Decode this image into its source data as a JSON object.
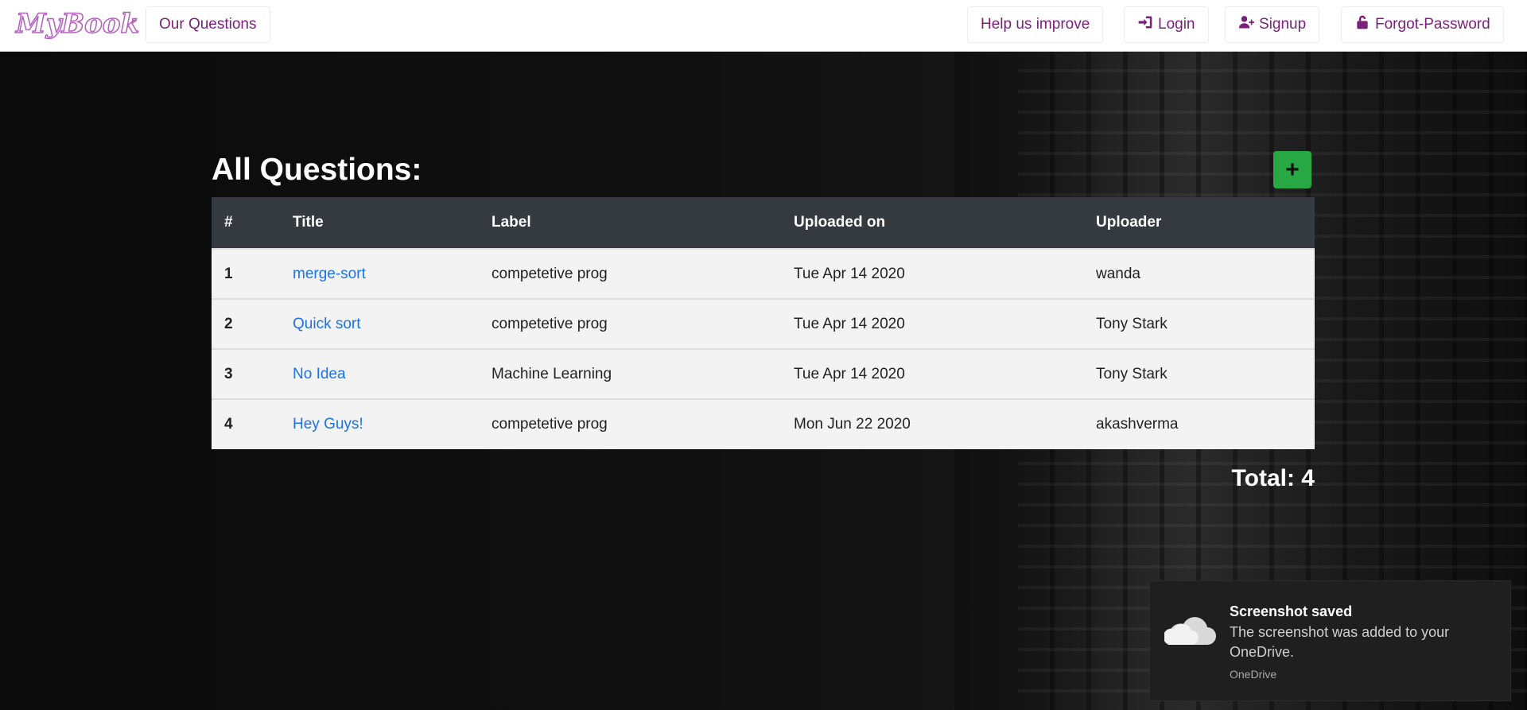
{
  "brand": "MyBook",
  "nav": {
    "questions": "Our Questions",
    "help": "Help us improve",
    "login": "Login",
    "signup": "Signup",
    "forgot": "Forgot-Password"
  },
  "page": {
    "heading": "All Questions:",
    "add_label": "+",
    "total": "Total: 4"
  },
  "table": {
    "headers": [
      "#",
      "Title",
      "Label",
      "Uploaded on",
      "Uploader"
    ],
    "rows": [
      {
        "num": "1",
        "title": "merge-sort",
        "label": "competetive prog",
        "date": "Tue Apr 14 2020",
        "uploader": "wanda"
      },
      {
        "num": "2",
        "title": "Quick sort",
        "label": "competetive prog",
        "date": "Tue Apr 14 2020",
        "uploader": "Tony Stark"
      },
      {
        "num": "3",
        "title": "No Idea",
        "label": "Machine Learning",
        "date": "Tue Apr 14 2020",
        "uploader": "Tony Stark"
      },
      {
        "num": "4",
        "title": "Hey Guys!",
        "label": "competetive prog",
        "date": "Mon Jun 22 2020",
        "uploader": "akashverma"
      }
    ]
  },
  "toast": {
    "title": "Screenshot saved",
    "body": "The screenshot was added to your OneDrive.",
    "source": "OneDrive"
  },
  "colors": {
    "brand": "#b35fbf",
    "nav_text": "#7a1f7a",
    "link": "#1a73e8",
    "add_button": "#28a745",
    "table_header": "#343a40"
  },
  "icons": {
    "login": "sign-in-icon",
    "signup": "user-plus-icon",
    "forgot": "unlock-icon",
    "toast": "onedrive-cloud-icon"
  }
}
